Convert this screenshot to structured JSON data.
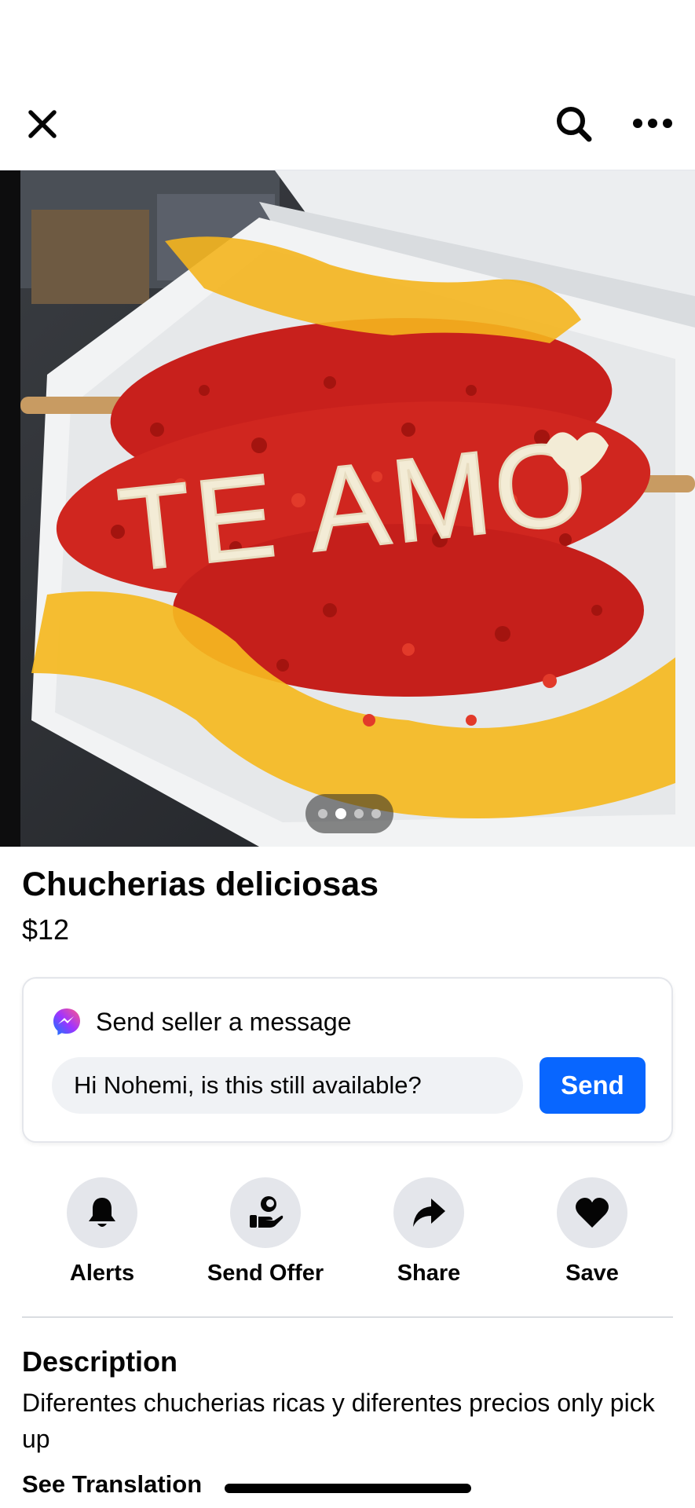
{
  "header": {
    "close_icon": "close-icon",
    "search_icon": "search-icon",
    "more_icon": "more-horizontal-icon"
  },
  "listing": {
    "photo": {
      "description_icon": "listing-photo",
      "photo_text": "TE AMO",
      "carousel": {
        "total": 4,
        "active_index": 1
      }
    },
    "title": "Chucherias deliciosas",
    "price": "$12"
  },
  "message": {
    "heading": "Send seller a message",
    "input_value": "Hi Nohemi, is this still available?",
    "send_label": "Send"
  },
  "actions": [
    {
      "label": "Alerts",
      "icon": "bell-icon"
    },
    {
      "label": "Send Offer",
      "icon": "offer-icon"
    },
    {
      "label": "Share",
      "icon": "share-icon"
    },
    {
      "label": "Save",
      "icon": "heart-icon"
    }
  ],
  "description": {
    "heading": "Description",
    "body": "Diferentes chucherias ricas y diferentes precios only pick up",
    "see_translation": "See Translation"
  },
  "colors": {
    "accent": "#0866ff",
    "text": "#050505",
    "action_bg": "#e4e6eb"
  }
}
